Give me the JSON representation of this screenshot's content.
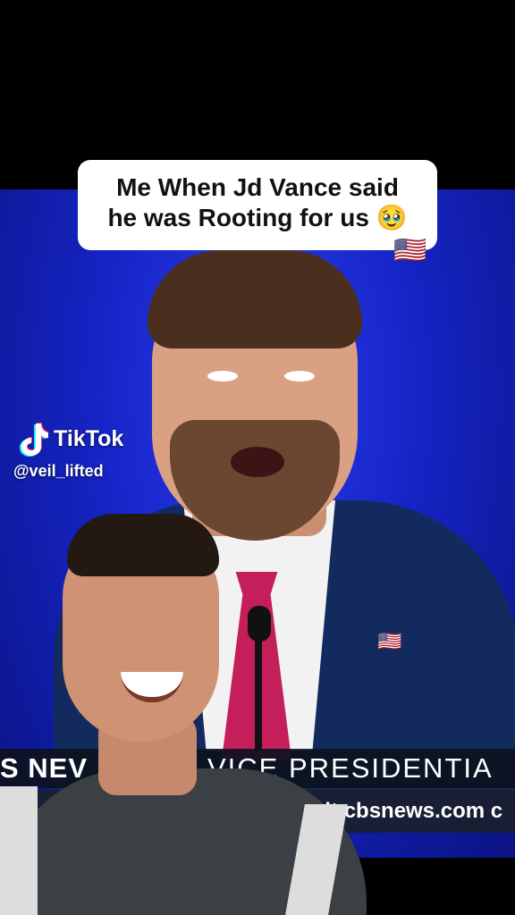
{
  "caption": {
    "text": "Me When Jd Vance said\nhe was Rooting for us 🥹",
    "flag_emoji": "🇺🇸"
  },
  "watermark": {
    "brand": "TikTok",
    "handle": "@veil_lifted",
    "icon": "tiktok-logo-icon"
  },
  "chyron": {
    "left_text": "S NEV",
    "right_text": "VICE PRESIDENTIA",
    "url_text": "visit cbsnews.com c"
  },
  "lapel_pin": "🇺🇸",
  "colors": {
    "background_blue": "#1524c4",
    "tie": "#c41f5a",
    "suit": "#132a5e"
  }
}
